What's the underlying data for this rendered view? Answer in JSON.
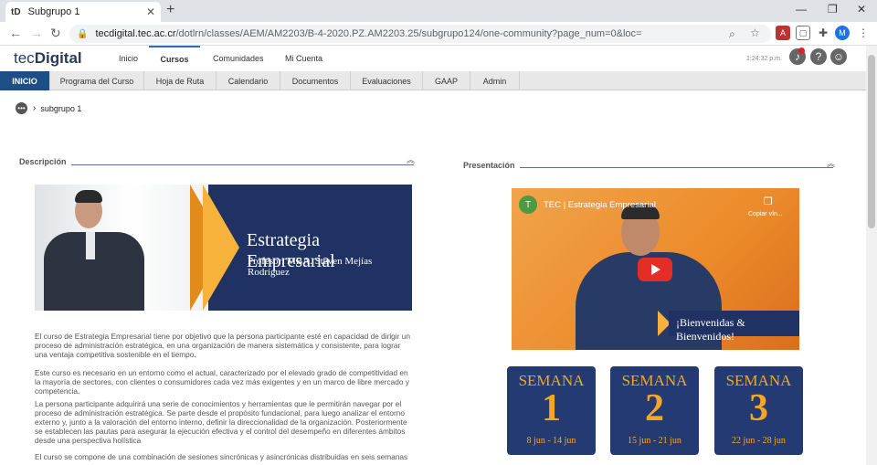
{
  "browser": {
    "tab_favicon": "tD",
    "tab_title": "Subgrupo 1",
    "url_host": "tecdigital.tec.ac.cr",
    "url_path": "/dotlrn/classes/AEM/AM2203/B-4-2020.PZ.AM2203.25/subgrupo124/one-community?page_num=0&loc=",
    "profile_initial": "M"
  },
  "header": {
    "logo_main": "tec",
    "logo_bold": "Digital",
    "nav": [
      "Inicio",
      "Cursos",
      "Comunidades",
      "Mi Cuenta"
    ],
    "active_nav": "Cursos",
    "clock": "1:24:32 p.m."
  },
  "subnav": [
    "INICIO",
    "Programa del Curso",
    "Hoja de Ruta",
    "Calendario",
    "Documentos",
    "Evaluaciones",
    "GAAP",
    "Admin"
  ],
  "breadcrumb": {
    "current": "subgrupo 1"
  },
  "descripcion": {
    "title": "Descripción",
    "banner_title": "Estrategia Empresarial",
    "banner_subtitle": "Profesor: MBA. Steven Mejías Rodríguez",
    "paragraphs": [
      "El curso de Estrategia Empresarial tiene por objetivo que la persona participante esté en capacidad de dirigir un proceso de administración estratégica, en una organización de manera sistemática y consistente, para lograr una ventaja competitiva sostenible en el tiempo.",
      "Este curso es necesario en un entorno como el actual, caracterizado por el elevado grado de competitividad en la mayoría de sectores, con clientes o consumidores cada vez más exigentes y en un marco de libre mercado y competencia.",
      "La persona participante adquirirá una serie de conocimientos y herramientas que le permitirán navegar por el proceso de administración estratégica. Se parte desde el propósito fundacional, para luego analizar el entorno externo y, junto a la valoración del entorno interno, definir la direccionalidad de la organización. Posteriormente se establecen las pautas para asegurar la ejecución efectiva y el control del desempeño en diferentes ámbitos desde una perspectiva holística",
      "El curso se compone de una combinación de sesiones sincrónicas y asincrónicas distribuidas en seis semanas"
    ]
  },
  "presentacion": {
    "title": "Presentación",
    "video_channel_initial": "T",
    "video_title": "TEC | Estrategia Empresarial",
    "video_copy": "Copiar vín...",
    "video_banner": "¡Bienvenidas & Bienvenidos!",
    "weeks": [
      {
        "label": "SEMANA",
        "number": "1",
        "dates": "8 jun - 14 jun"
      },
      {
        "label": "SEMANA",
        "number": "2",
        "dates": "15 jun - 21 jun"
      },
      {
        "label": "SEMANA",
        "number": "3",
        "dates": "22 jun - 28 jun"
      }
    ]
  },
  "colors": {
    "brand_blue": "#1e4e86",
    "accent_orange": "#f5a623",
    "week_bg": "#233a73"
  }
}
